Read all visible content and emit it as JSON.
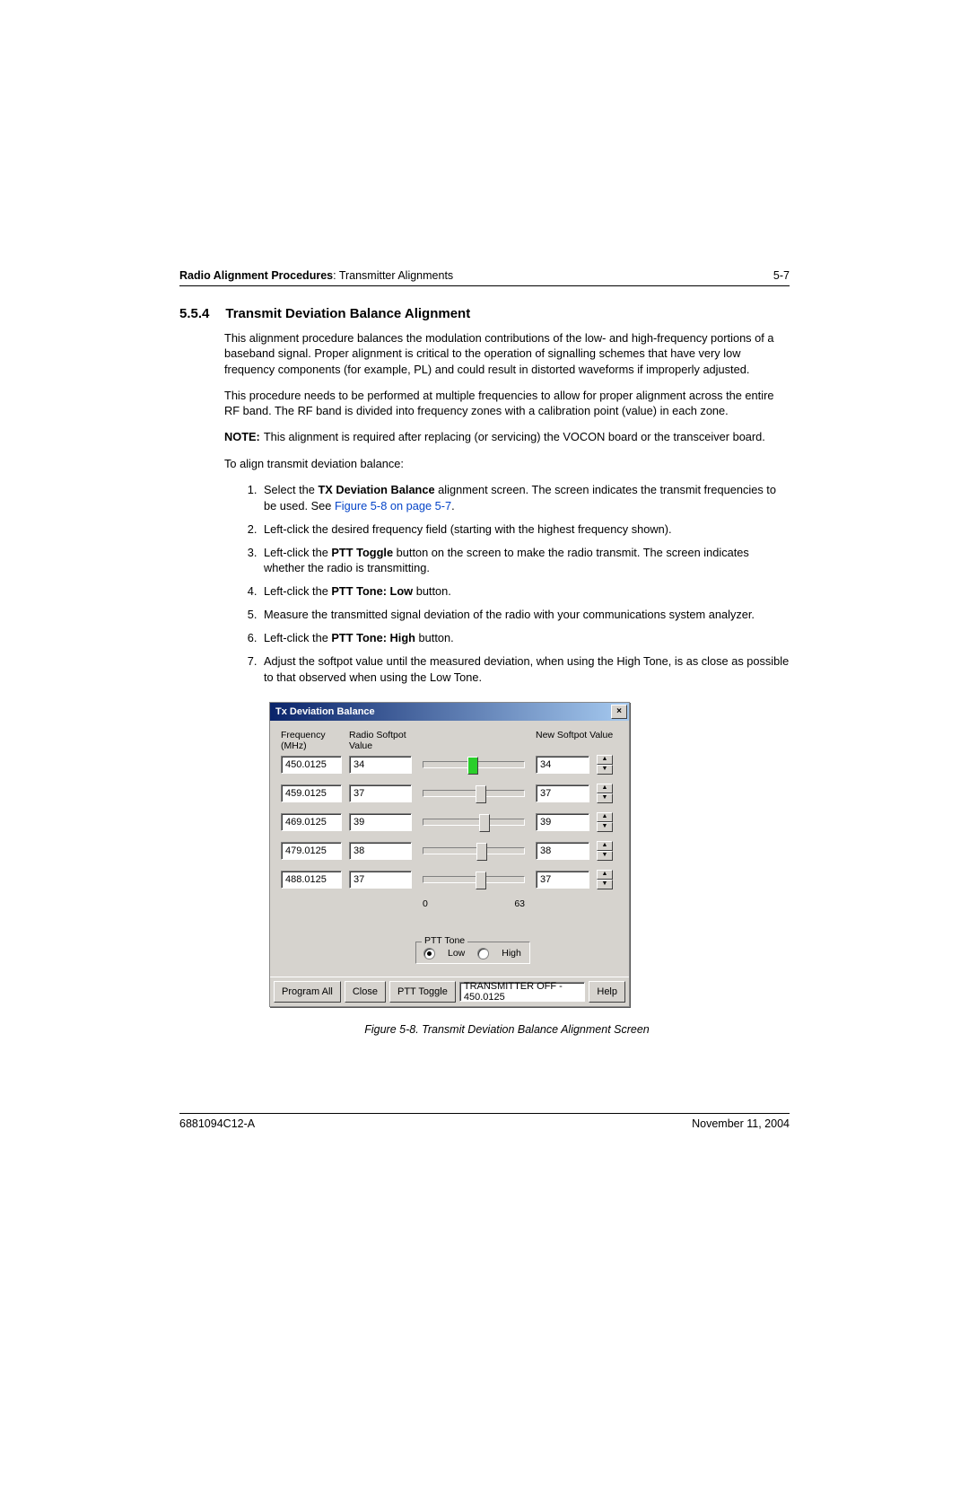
{
  "header": {
    "chapter": "Radio Alignment Procedures",
    "sub": ": Transmitter Alignments",
    "page": "5-7"
  },
  "section": {
    "number": "5.5.4",
    "title": "Transmit Deviation Balance Alignment"
  },
  "paras": {
    "p1": "This alignment procedure balances the modulation contributions of the low- and high-frequency portions of a baseband signal. Proper alignment is critical to the operation of signalling schemes that have very low frequency components (for example, PL) and could result in distorted waveforms if improperly adjusted.",
    "p2": "This procedure needs to be performed at multiple frequencies to allow for proper alignment across the entire RF band. The RF band is divided into frequency zones with a calibration point (value) in each zone.",
    "note_label": "NOTE:",
    "note": "This alignment is required after replacing (or servicing) the VOCON board or the transceiver board.",
    "intro": "To align transmit deviation balance:"
  },
  "steps": {
    "s1a": "Select the ",
    "s1b": "TX Deviation Balance",
    "s1c": " alignment screen. The screen indicates the transmit frequencies to be used. See ",
    "s1link": "Figure 5-8 on page 5-7",
    "s1d": ".",
    "s2": "Left-click the desired frequency field (starting with the highest frequency shown).",
    "s3a": "Left-click the ",
    "s3b": "PTT Toggle",
    "s3c": " button on the screen to make the radio transmit. The screen indicates whether the radio is transmitting.",
    "s4a": "Left-click the ",
    "s4b": "PTT Tone: Low",
    "s4c": " button.",
    "s5": "Measure the transmitted signal deviation of the radio with your communications system analyzer.",
    "s6a": "Left-click the ",
    "s6b": "PTT Tone: High",
    "s6c": " button.",
    "s7": "Adjust the softpot value until the measured deviation, when using the High Tone, is as close as possible to that observed when using the Low Tone."
  },
  "dialog": {
    "title": "Tx Deviation Balance",
    "col_freq": "Frequency (MHz)",
    "col_radio": "Radio Softpot Value",
    "col_new": "New Softpot Value",
    "scale_min": "0",
    "scale_max": "63",
    "rows": [
      {
        "freq": "450.0125",
        "radio": "34",
        "new": "34",
        "pos": 44,
        "active": true
      },
      {
        "freq": "459.0125",
        "radio": "37",
        "new": "37",
        "pos": 52,
        "active": false
      },
      {
        "freq": "469.0125",
        "radio": "39",
        "new": "39",
        "pos": 55,
        "active": false
      },
      {
        "freq": "479.0125",
        "radio": "38",
        "new": "38",
        "pos": 53,
        "active": false
      },
      {
        "freq": "488.0125",
        "radio": "37",
        "new": "37",
        "pos": 52,
        "active": false
      }
    ],
    "ptt_group": "PTT Tone",
    "ptt_low": "Low",
    "ptt_high": "High",
    "btn_program": "Program All",
    "btn_close": "Close",
    "btn_ptt": "PTT Toggle",
    "status": "TRANSMITTER OFF - 450.0125",
    "btn_help": "Help"
  },
  "figure_caption": "Figure 5-8.  Transmit Deviation Balance Alignment Screen",
  "footer": {
    "docnum": "6881094C12-A",
    "date": "November 11, 2004"
  }
}
